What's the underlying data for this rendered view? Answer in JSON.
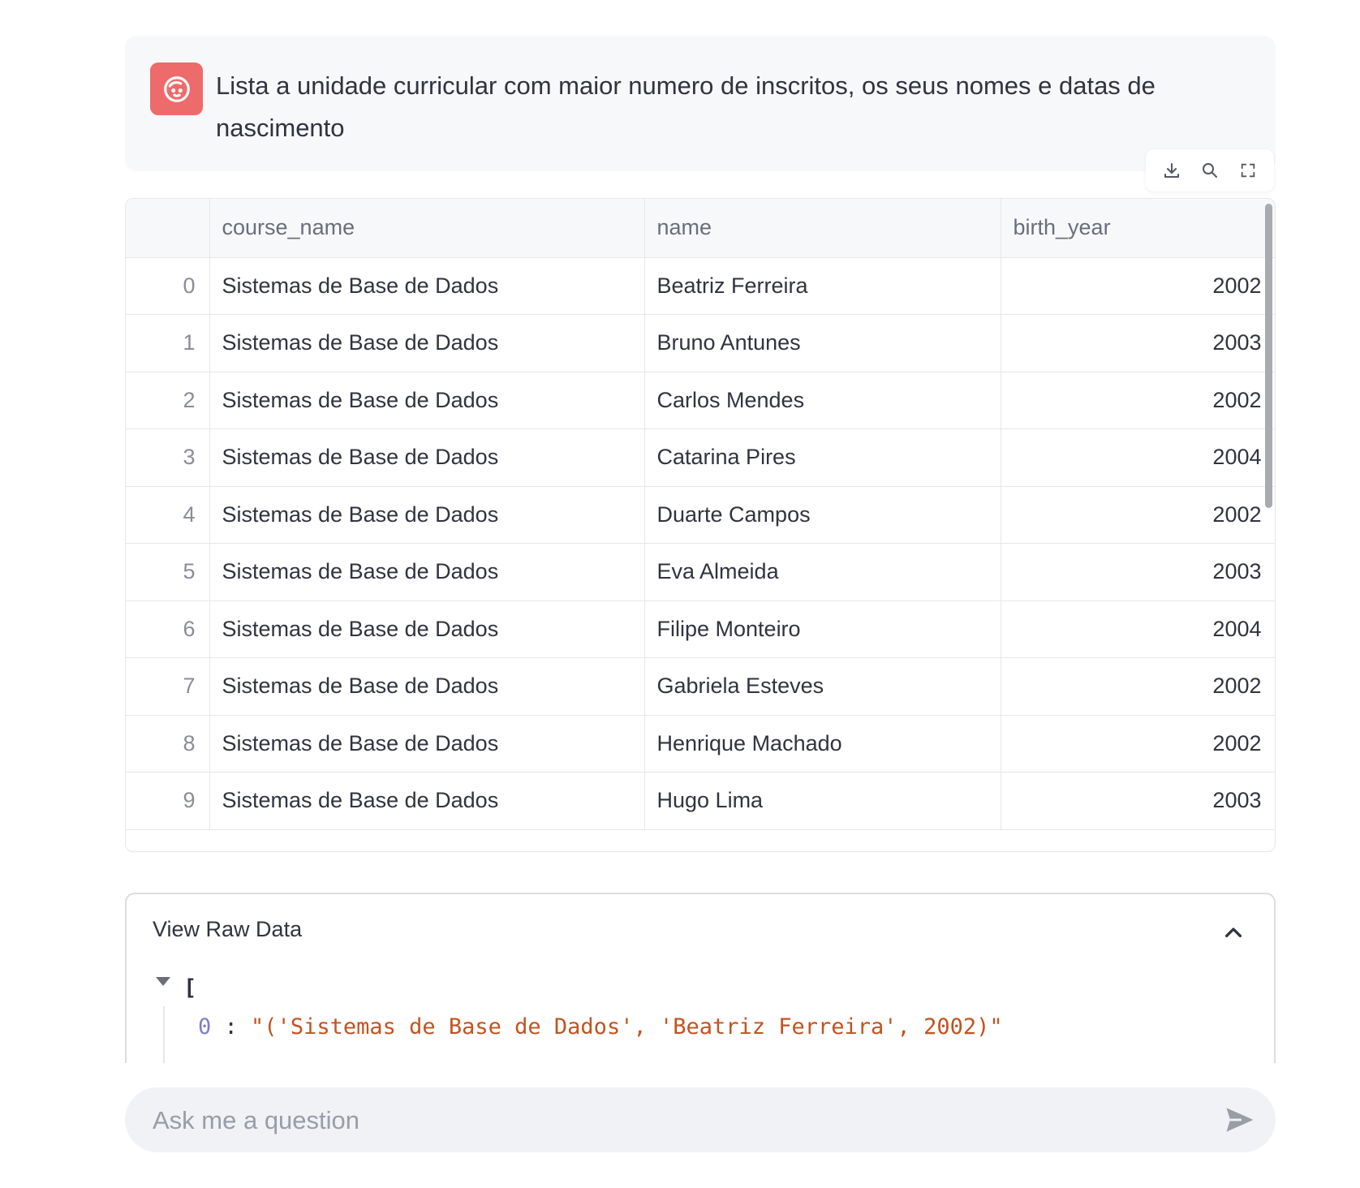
{
  "message": {
    "text": "Lista a unidade curricular com maior numero de inscritos, os seus nomes e datas de nascimento",
    "avatar_icon": "user-face-icon",
    "avatar_color": "#ee6b6b"
  },
  "toolbar": {
    "icons": [
      "download-icon",
      "search-icon",
      "fullscreen-icon"
    ]
  },
  "table": {
    "columns": [
      "",
      "course_name",
      "name",
      "birth_year"
    ],
    "rows": [
      {
        "index": "0",
        "course_name": "Sistemas de Base de Dados",
        "name": "Beatriz Ferreira",
        "birth_year": "2002"
      },
      {
        "index": "1",
        "course_name": "Sistemas de Base de Dados",
        "name": "Bruno Antunes",
        "birth_year": "2003"
      },
      {
        "index": "2",
        "course_name": "Sistemas de Base de Dados",
        "name": "Carlos Mendes",
        "birth_year": "2002"
      },
      {
        "index": "3",
        "course_name": "Sistemas de Base de Dados",
        "name": "Catarina Pires",
        "birth_year": "2004"
      },
      {
        "index": "4",
        "course_name": "Sistemas de Base de Dados",
        "name": "Duarte Campos",
        "birth_year": "2002"
      },
      {
        "index": "5",
        "course_name": "Sistemas de Base de Dados",
        "name": "Eva Almeida",
        "birth_year": "2003"
      },
      {
        "index": "6",
        "course_name": "Sistemas de Base de Dados",
        "name": "Filipe Monteiro",
        "birth_year": "2004"
      },
      {
        "index": "7",
        "course_name": "Sistemas de Base de Dados",
        "name": "Gabriela Esteves",
        "birth_year": "2002"
      },
      {
        "index": "8",
        "course_name": "Sistemas de Base de Dados",
        "name": "Henrique Machado",
        "birth_year": "2002"
      },
      {
        "index": "9",
        "course_name": "Sistemas de Base de Dados",
        "name": "Hugo Lima",
        "birth_year": "2003"
      }
    ]
  },
  "raw_data": {
    "title": "View Raw Data",
    "open_bracket": "[",
    "first_key": "0",
    "first_value": "\"('Sistemas de Base de Dados', 'Beatriz Ferreira', 2002)\""
  },
  "chat_input": {
    "placeholder": "Ask me a question"
  }
}
